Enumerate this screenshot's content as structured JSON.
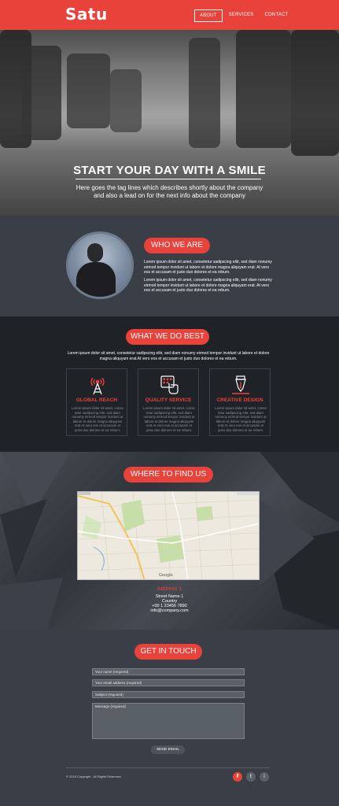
{
  "header": {
    "logo": "Satu",
    "nav": [
      "ABOUT",
      "SERVICES",
      "CONTACT"
    ],
    "active": "ABOUT"
  },
  "hero": {
    "title": "START YOUR DAY WITH A SMILE",
    "tagline": "Here goes the tag lines which describes shortly about the company and also a lead on for the next info about the company"
  },
  "who": {
    "heading": "WHO WE ARE",
    "p1": "Lorem ipsum dolor sit amet, consetetur sadipscing elitr, sed diam nonumy eirmod tempor invidunt ut labore et dolore magna aliquyam erat. At vero eos et accusam et justo duo dolores et ea rebum.",
    "p2": "Lorem ipsum dolor sit amet, consetetur sadipscing elitr, sed diam nonumy eirmod tempor invidunt ut labore et dolore magna aliquyam erat. At vero eos et accusam et justo duo dolores et ea rebum."
  },
  "what": {
    "heading": "WHAT WE DO BEST",
    "description": "Lorem ipsum dolor sit amet, consetetur sadipscing elitr, sed diam nonumy eirmod tempor invidunt ut labore et dolore magna aliquyam erat.At vero eos et accusam et justo duo dolores et ea rebum.",
    "cards": [
      {
        "icon": "antenna-icon",
        "title": "GLOBAL REACH",
        "text": "Lorem ipsum dolor sit amet, conse tetur sadipscing elitr, sed diam nonumy eirmod tempor invidunt ut labore et dolore magna aliquyam erat.At vero eos et accusam et justo duo dolores et ea rebum."
      },
      {
        "icon": "touch-keypad-icon",
        "title": "QUALITY SERVICE",
        "text": "Lorem ipsum dolor sit amet, conse tetur sadipscing elitr, sed diam nonumy eirmod tempor invidunt ut labore et dolore magna aliquyam erat.At vero eos et accusam et justo duo dolores et ea rebum."
      },
      {
        "icon": "pen-nib-icon",
        "title": "CREATIVE DESIGN",
        "text": "Lorem ipsum dolor sit amet, conse tetur sadipscing elitr, sed diam nonumy eirmod tempor invidunt ut labore et dolore magna aliquyam erat.At vero eos et accusam et justo duo dolores et ea rebum."
      }
    ]
  },
  "where": {
    "heading": "WHERE TO FIND US",
    "address_title": "Address 1",
    "address_lines": [
      "Street Name 1",
      "Country",
      "+00 1 23456 7890",
      "info@company.com"
    ],
    "map_label": "Google"
  },
  "touch": {
    "heading": "GET IN TOUCH",
    "name_placeholder": "Your name (required)",
    "email_placeholder": "Your email address (required)",
    "subject_placeholder": "Subject (required)",
    "message_placeholder": "Message (required)",
    "send": "SEND EMAIL",
    "copyright": "© 2015 Copyright . All Rights Reserved.",
    "social": [
      "f",
      "t",
      "i"
    ]
  },
  "colors": {
    "accent": "#e8423a",
    "dark": "#1f2227",
    "panel": "#3a3f47"
  }
}
